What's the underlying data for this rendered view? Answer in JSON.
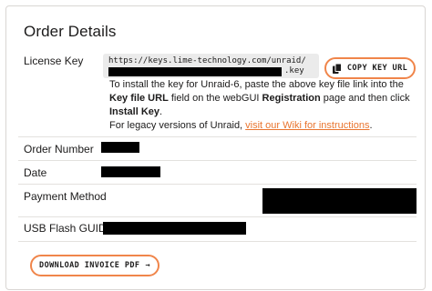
{
  "order": {
    "title": "Order Details",
    "license_key": {
      "label": "License Key",
      "url_prefix": "https://keys.lime-technology.com/unraid/",
      "url_suffix": ".key",
      "copy_button_label": "COPY KEY URL",
      "copy_icon": "copy-icon"
    },
    "instructions": {
      "part1": "To install the key for Unraid-6, paste the above key file link into the ",
      "key_file_url": "Key file URL",
      "part2": " field on the webGUI ",
      "registration": "Registration",
      "part3": " page and then click ",
      "install_key": "Install Key",
      "part4": "."
    },
    "legacy": {
      "prefix": "For legacy versions of Unraid, ",
      "link_text": "visit our Wiki for instructions",
      "suffix": "."
    },
    "fields": {
      "order_number_label": "Order Number",
      "date_label": "Date",
      "payment_method_label": "Payment Method",
      "usb_flash_guid_label": "USB Flash GUID"
    },
    "download_button_label": "DOWNLOAD INVOICE PDF",
    "download_arrow": "→",
    "colors": {
      "accent": "#f0854a",
      "link": "#e9752f",
      "text": "#1c1b1b",
      "redaction": "#000000"
    }
  }
}
